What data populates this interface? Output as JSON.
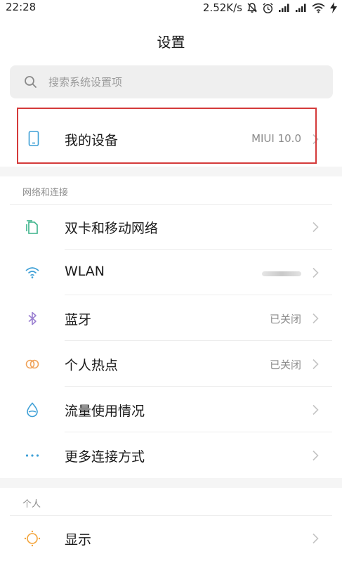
{
  "status_bar": {
    "time": "22:28",
    "speed": "2.52K/s"
  },
  "title": "设置",
  "search": {
    "placeholder": "搜索系统设置项"
  },
  "device": {
    "label": "我的设备",
    "value": "MIUI 10.0"
  },
  "sections": {
    "network": {
      "header": "网络和连接",
      "items": [
        {
          "label": "双卡和移动网络",
          "value": "",
          "icon": "sim-card-icon"
        },
        {
          "label": "WLAN",
          "value": "",
          "icon": "wifi-icon"
        },
        {
          "label": "蓝牙",
          "value": "已关闭",
          "icon": "bluetooth-icon"
        },
        {
          "label": "个人热点",
          "value": "已关闭",
          "icon": "hotspot-icon"
        },
        {
          "label": "流量使用情况",
          "value": "",
          "icon": "data-usage-icon"
        },
        {
          "label": "更多连接方式",
          "value": "",
          "icon": "more-dots-icon"
        }
      ]
    },
    "personal": {
      "header": "个人",
      "items": [
        {
          "label": "显示",
          "value": "",
          "icon": "display-brightness-icon"
        }
      ]
    }
  },
  "colors": {
    "accent_blue": "#3d9fd6",
    "highlight_red": "#d43a3a",
    "bluetooth_purple": "#9a7fd1",
    "hotspot_orange": "#f0a35a",
    "display_orange": "#f3a43a"
  }
}
